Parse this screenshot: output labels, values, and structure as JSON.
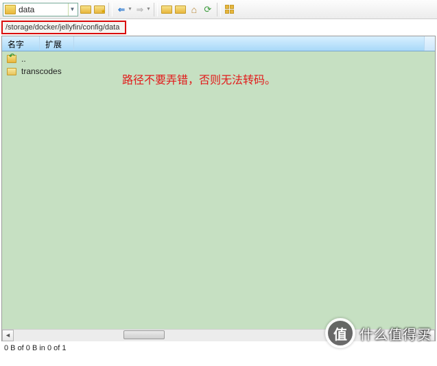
{
  "toolbar": {
    "current_folder": "data"
  },
  "pathbar": {
    "path": "/storage/docker/jellyfin/config/data"
  },
  "columns": {
    "name": "名字",
    "ext": "扩展"
  },
  "rows": {
    "parent": "..",
    "item0": "transcodes"
  },
  "annotation": "路径不要弄错，否则无法转码。",
  "status": "0 B of 0 B in 0 of 1",
  "watermark": {
    "symbol": "值",
    "text": "什么值得买"
  }
}
